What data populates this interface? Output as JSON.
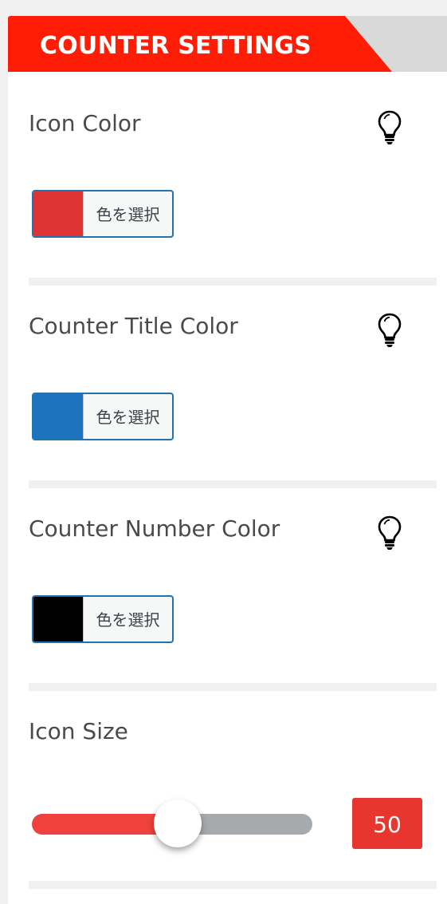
{
  "header": {
    "title": "COUNTER SETTINGS"
  },
  "settings": [
    {
      "label": "Icon Color",
      "swatch": "#dd3333",
      "picker_label": "色を選択",
      "has_hint": true
    },
    {
      "label": "Counter Title Color",
      "swatch": "#1e73be",
      "picker_label": "色を選択",
      "has_hint": true
    },
    {
      "label": "Counter Number Color",
      "swatch": "#000000",
      "picker_label": "色を選択",
      "has_hint": true
    }
  ],
  "icon_size": {
    "label": "Icon Size",
    "value": "50",
    "fraction": 0.6
  },
  "colors": {
    "accent": "#ff1d06",
    "slider_fill": "#f1413c",
    "value_box": "#e8352e"
  }
}
